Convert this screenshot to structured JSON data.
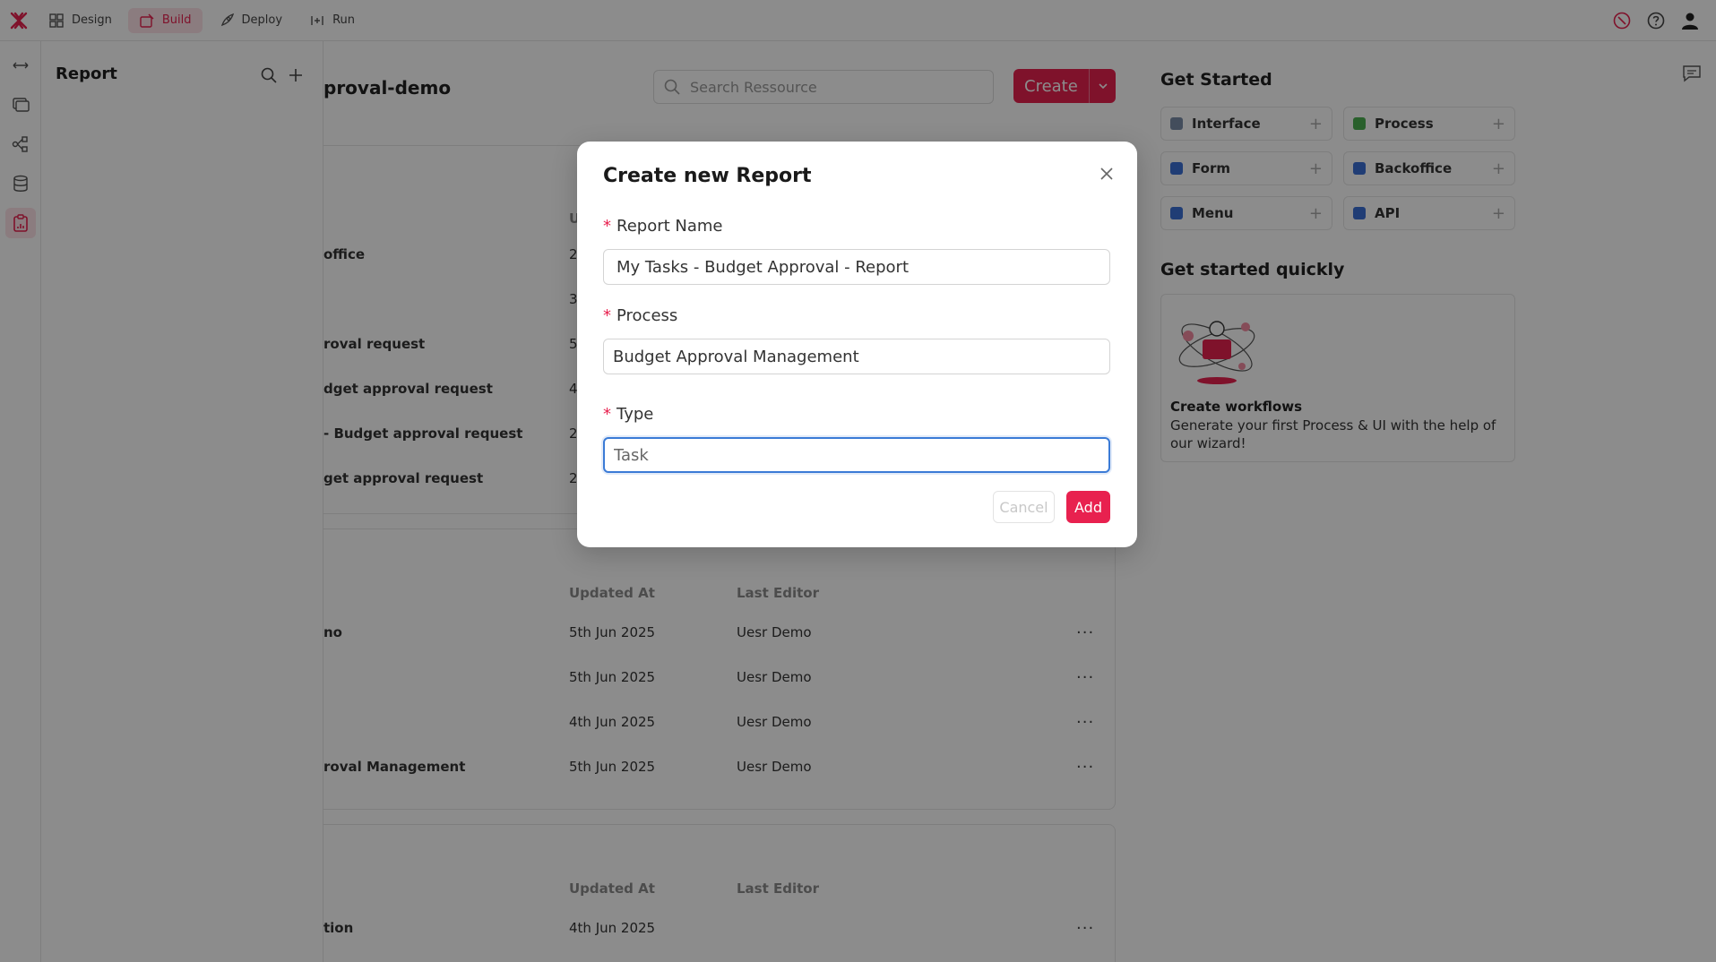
{
  "topbar": {
    "nav": [
      {
        "label": "Design",
        "icon": "grid-icon"
      },
      {
        "label": "Build",
        "icon": "build-icon",
        "active": true
      },
      {
        "label": "Deploy",
        "icon": "rocket-icon"
      },
      {
        "label": "Run",
        "icon": "run-icon"
      }
    ],
    "accent": "#e8214f"
  },
  "panel": {
    "title": "Report"
  },
  "main": {
    "project_title": "proval-demo",
    "search_placeholder": "Search Ressource",
    "create_label": "Create",
    "section1": {
      "col_updated": "U",
      "rows": [
        {
          "name": "office",
          "date": "2"
        },
        {
          "name": "",
          "date": "3"
        },
        {
          "name": "roval request",
          "date": "5"
        },
        {
          "name": "dget approval request",
          "date": "4"
        },
        {
          "name": "- Budget approval request",
          "date": "2"
        },
        {
          "name": "get approval request",
          "date": "2"
        }
      ]
    },
    "section2": {
      "col_updated": "Updated At",
      "col_editor": "Last Editor",
      "rows": [
        {
          "name": "no",
          "date": "5th Jun 2025",
          "editor": "Uesr Demo"
        },
        {
          "name": "",
          "date": "5th Jun 2025",
          "editor": "Uesr Demo"
        },
        {
          "name": "",
          "date": "4th Jun 2025",
          "editor": "Uesr Demo"
        },
        {
          "name": "roval Management",
          "date": "5th Jun 2025",
          "editor": "Uesr Demo"
        }
      ]
    },
    "section3": {
      "col_updated": "Updated At",
      "col_editor": "Last Editor",
      "rows": [
        {
          "name": "tion",
          "date": "4th Jun 2025",
          "editor": ""
        }
      ]
    },
    "menu_glyph": "···"
  },
  "get_started": {
    "title": "Get Started",
    "tiles": [
      {
        "label": "Interface",
        "color": "#7a8ca8"
      },
      {
        "label": "Process",
        "color": "#4caf50"
      },
      {
        "label": "Form",
        "color": "#3b6fd6"
      },
      {
        "label": "Backoffice",
        "color": "#3b6fd6"
      },
      {
        "label": "Menu",
        "color": "#3b6fd6"
      },
      {
        "label": "API",
        "color": "#3b6fd6"
      }
    ],
    "plus": "+",
    "quick_title": "Get started quickly",
    "quick_card_title": "Create workflows",
    "quick_card_desc": "Generate your first Process & UI with the help of our wizard!"
  },
  "modal": {
    "title": "Create new Report",
    "required_mark": "*",
    "report_name_label": "Report Name",
    "report_name_value": "My Tasks - Budget Approval - Report",
    "process_label": "Process",
    "process_value": "Budget Approval Management",
    "type_label": "Type",
    "type_value": "Task",
    "cancel_label": "Cancel",
    "add_label": "Add"
  }
}
